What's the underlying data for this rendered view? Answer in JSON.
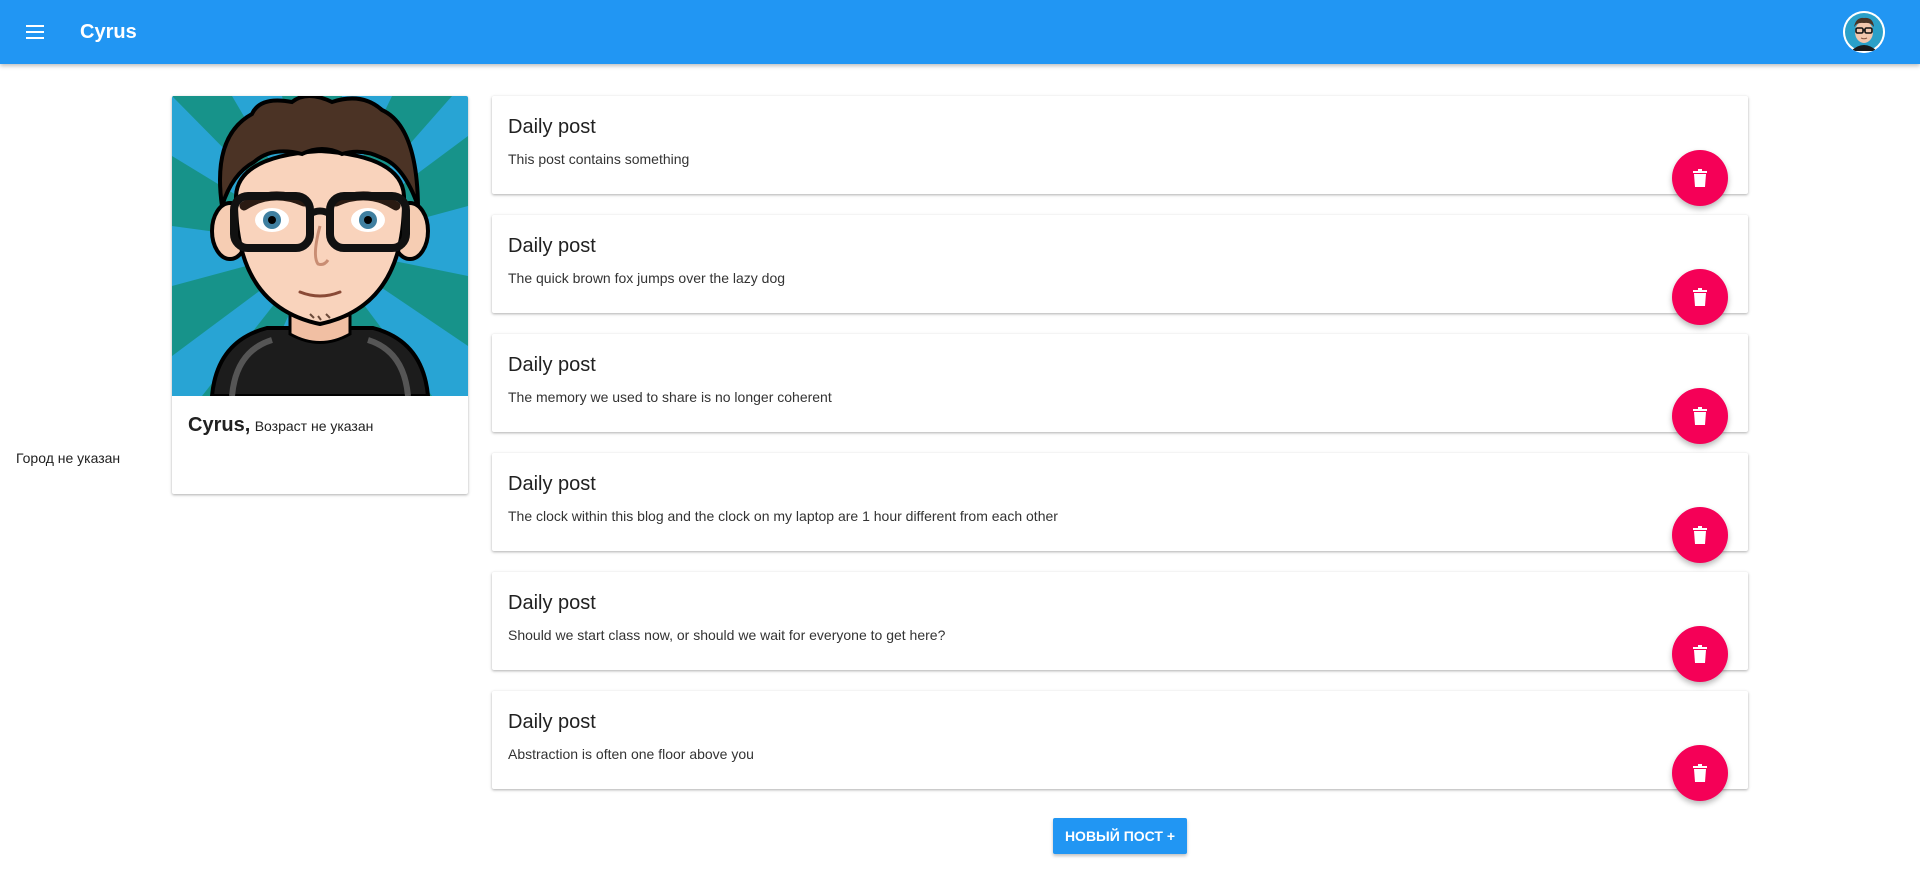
{
  "appbar": {
    "title": "Cyrus",
    "menu_icon": "menu-icon",
    "avatar_icon": "user-avatar"
  },
  "profile": {
    "name": "Cyrus,",
    "age": "Возраст не указан",
    "city": "Город не указан"
  },
  "posts": [
    {
      "title": "Daily post",
      "body": "This post contains something"
    },
    {
      "title": "Daily post",
      "body": "The quick brown fox jumps over the lazy dog"
    },
    {
      "title": "Daily post",
      "body": "The memory we used to share is no longer coherent"
    },
    {
      "title": "Daily post",
      "body": "The clock within this blog and the clock on my laptop are 1 hour different from each other"
    },
    {
      "title": "Daily post",
      "body": "Should we start class now, or should we wait for everyone to get here?"
    },
    {
      "title": "Daily post",
      "body": "Abstraction is often one floor above you"
    }
  ],
  "new_post_label": "НОВЫЙ ПОСТ +",
  "colors": {
    "primary": "#2196f3",
    "accent": "#f50057"
  },
  "icons": {
    "delete": "trash-icon"
  }
}
